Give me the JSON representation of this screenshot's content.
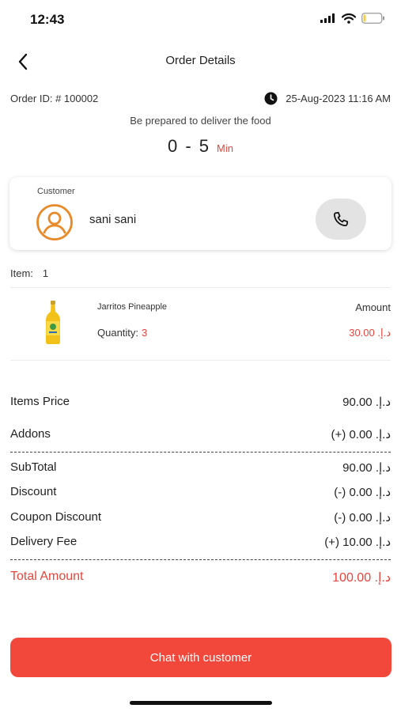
{
  "status_bar": {
    "time": "12:43"
  },
  "header": {
    "title": "Order Details"
  },
  "order": {
    "id_label": "Order ID: # 100002",
    "datetime": "25-Aug-2023 11:16 AM",
    "prepare_message": "Be prepared to deliver the food",
    "time_range": "0 - 5",
    "time_unit": "Min"
  },
  "customer": {
    "label": "Customer",
    "name": "sani sani"
  },
  "items": {
    "count_label": "Item:",
    "count": "1",
    "list": [
      {
        "name": "Jarritos Pineapple",
        "amount_label": "Amount",
        "quantity_label": "Quantity:",
        "quantity": "3",
        "price": "30.00 .د.إ"
      }
    ]
  },
  "summary": {
    "items_price": {
      "label": "Items Price",
      "value": "90.00 .د.إ"
    },
    "addons": {
      "label": "Addons",
      "value": "(+) 0.00 .د.إ"
    },
    "subtotal": {
      "label": "SubTotal",
      "value": "90.00 .د.إ"
    },
    "discount": {
      "label": "Discount",
      "value": "(-) 0.00 .د.إ"
    },
    "coupon_discount": {
      "label": "Coupon Discount",
      "value": "(-) 0.00 .د.إ"
    },
    "delivery_fee": {
      "label": "Delivery Fee",
      "value": "(+) 10.00 .د.إ"
    },
    "total": {
      "label": "Total Amount",
      "value": "100.00 .د.إ"
    }
  },
  "actions": {
    "chat_label": "Chat with customer"
  },
  "colors": {
    "accent": "#f2473b",
    "accent_text": "#e8453c",
    "avatar_orange": "#e88a2a",
    "call_bg": "#e3e3e3"
  },
  "icons": {
    "back": "chevron-left-icon",
    "clock": "clock-icon",
    "avatar": "user-circle-icon",
    "call": "phone-icon"
  }
}
